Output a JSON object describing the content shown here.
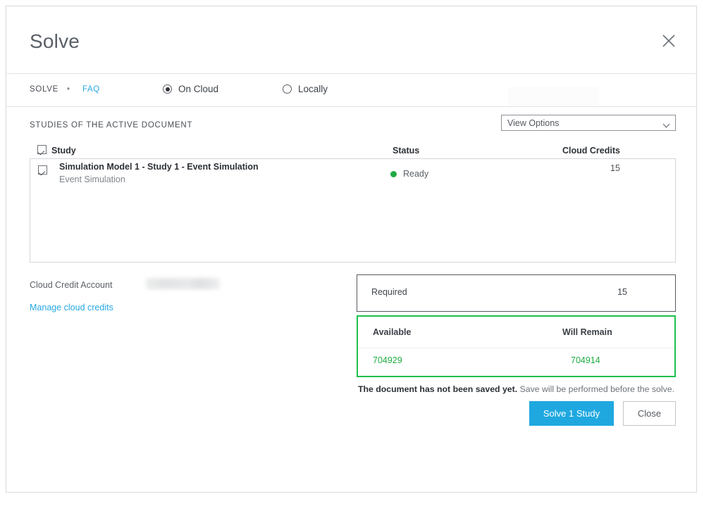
{
  "dialog": {
    "title": "Solve",
    "close_icon": "close-icon"
  },
  "toolbar": {
    "breadcrumb_root": "SOLVE",
    "breadcrumb_separator": "•",
    "faq_link": "FAQ",
    "location_options": [
      {
        "label": "On Cloud",
        "selected": true
      },
      {
        "label": "Locally",
        "selected": false
      }
    ]
  },
  "studies_section": {
    "section_label": "STUDIES OF THE ACTIVE DOCUMENT",
    "view_options": {
      "value": "View Options",
      "chevron_icon": "chevron-down-icon"
    },
    "select_all_checked": true,
    "columns": [
      "Study",
      "Status",
      "Cloud Credits"
    ],
    "rows": [
      {
        "checked": true,
        "name": "Simulation Model 1 - Study 1 - Event Simulation",
        "subtitle": "Event Simulation",
        "status": "Ready",
        "status_color": "#1fab43",
        "credits": "15"
      }
    ]
  },
  "account": {
    "label": "Cloud Credit Account",
    "value_redacted": true,
    "manage_link": "Manage cloud credits"
  },
  "credits": {
    "required_label": "Required",
    "required_value": "15",
    "available_label": "Available",
    "will_remain_label": "Will Remain",
    "available_value": "704929",
    "will_remain_value": "704914",
    "available_border_color": "#1ec04b",
    "value_color": "#1fab43"
  },
  "footer": {
    "save_note_bold": "The document has not been saved yet.",
    "save_note_rest": " Save will be performed before the solve.",
    "primary_button": "Solve 1 Study",
    "secondary_button": "Close",
    "primary_color": "#1fa8e0"
  }
}
